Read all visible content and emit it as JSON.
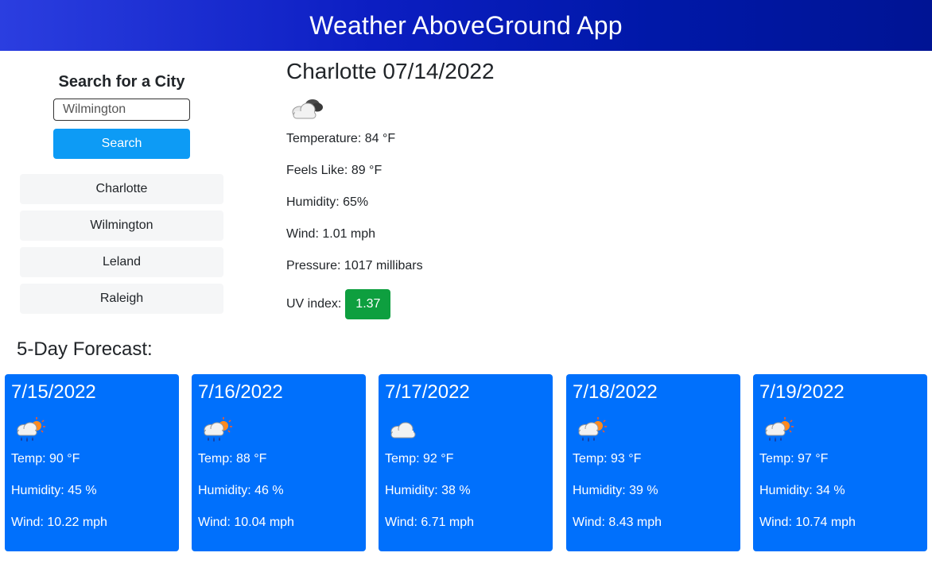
{
  "header": {
    "title": "Weather AboveGround App"
  },
  "sidebar": {
    "heading": "Search for a City",
    "search": {
      "value": "Wilmington",
      "placeholder": ""
    },
    "search_button": "Search",
    "history": [
      {
        "label": "Charlotte"
      },
      {
        "label": "Wilmington"
      },
      {
        "label": "Leland"
      },
      {
        "label": "Raleigh"
      }
    ]
  },
  "current": {
    "title": "Charlotte 07/14/2022",
    "icon": "partly-cloudy-night-icon",
    "temperature": "Temperature: 84 °F",
    "feels_like": "Feels Like: 89 °F",
    "humidity": "Humidity: 65%",
    "wind": "Wind: 1.01 mph",
    "pressure": "Pressure: 1017 millibars",
    "uv_label": "UV index:",
    "uv_value": "1.37",
    "uv_color": "#0e9f3f"
  },
  "forecast": {
    "heading": "5-Day Forecast:",
    "card_color": "#0070fc",
    "days": [
      {
        "date": "7/15/2022",
        "icon": "rain-sun-icon",
        "temp": "Temp: 90 °F",
        "humidity": "Humidity: 45 %",
        "wind": "Wind: 10.22 mph"
      },
      {
        "date": "7/16/2022",
        "icon": "rain-sun-icon",
        "temp": "Temp: 88 °F",
        "humidity": "Humidity: 46 %",
        "wind": "Wind: 10.04 mph"
      },
      {
        "date": "7/17/2022",
        "icon": "cloud-icon",
        "temp": "Temp: 92 °F",
        "humidity": "Humidity: 38 %",
        "wind": "Wind: 6.71 mph"
      },
      {
        "date": "7/18/2022",
        "icon": "rain-sun-icon",
        "temp": "Temp: 93 °F",
        "humidity": "Humidity: 39 %",
        "wind": "Wind: 8.43 mph"
      },
      {
        "date": "7/19/2022",
        "icon": "rain-sun-icon",
        "temp": "Temp: 97 °F",
        "humidity": "Humidity: 34 %",
        "wind": "Wind: 10.74 mph"
      }
    ]
  }
}
